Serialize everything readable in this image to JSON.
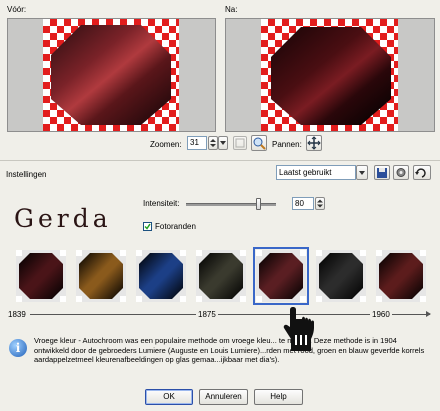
{
  "preview": {
    "before_label": "Vóór:",
    "after_label": "Na:"
  },
  "toolbar": {
    "zoom_label": "Zoomen:",
    "zoom_value": "31",
    "pan_label": "Pannen:"
  },
  "settings": {
    "label": "Instellingen",
    "preset_value": "Laatst gebruikt"
  },
  "effect": {
    "brand": "Gerda",
    "intensity_label": "Intensiteit:",
    "intensity_value": "80",
    "intensity_fraction": 0.8,
    "fotoranden_label": "Fotoranden",
    "fotoranden_checked": true
  },
  "presets": [
    {
      "name": "preset-1",
      "color": "#4a1418"
    },
    {
      "name": "preset-2",
      "color": "#8a5a1c"
    },
    {
      "name": "preset-3",
      "color": "#1c3f86"
    },
    {
      "name": "preset-4",
      "color": "#3a3a2e"
    },
    {
      "name": "preset-5",
      "color": "#5a1e22",
      "selected": true
    },
    {
      "name": "preset-6",
      "color": "#2c2c2c"
    },
    {
      "name": "preset-7",
      "color": "#5c1c1c"
    }
  ],
  "timeline": {
    "year_start": "1839",
    "year_mid": "1875",
    "year_end": "1960"
  },
  "info": {
    "description": "Vroege kleur - Autochroom was een populaire methode om vroege kleu... te maken. Deze methode is in 1904 ontwikkeld door de gebroeders Lumiere (Auguste en Louis Lumiere)...rden met rood, groen en blauw geverfde korrels aardappelzetmeel kleurenafbeeldingen op glas gemaa...ijkbaar met dia's)."
  },
  "buttons": {
    "ok": "OK",
    "cancel": "Annuleren",
    "help": "Help"
  },
  "colors": {
    "background": "#f0efe9",
    "check_red": "#e21d1d",
    "selection": "#3a67c8"
  }
}
